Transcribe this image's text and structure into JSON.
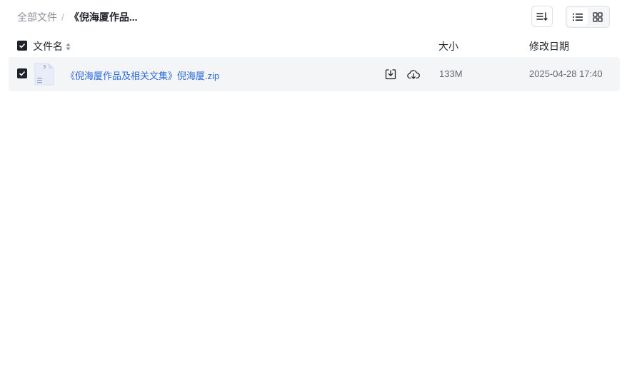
{
  "breadcrumb": {
    "root": "全部文件",
    "separator": "/",
    "current": "《倪海厦作品..."
  },
  "toolbar": {
    "sort_icon": "sort-list-icon",
    "view_list_icon": "list-view-icon",
    "view_grid_icon": "grid-view-icon",
    "active_view": "list"
  },
  "table": {
    "columns": {
      "name": "文件名",
      "size": "大小",
      "modified": "修改日期"
    },
    "header_checked": true,
    "rows": [
      {
        "checked": true,
        "icon": "zip-file-icon",
        "name": "《倪海厦作品及相关文集》倪海厦.zip",
        "size": "133M",
        "modified": "2025-04-28 17:40",
        "actions": [
          "download-icon",
          "cloud-save-icon"
        ]
      }
    ]
  },
  "colors": {
    "link": "#2a6bd9",
    "row_bg": "#f4f5f6",
    "checkbox": "#1f2329"
  }
}
